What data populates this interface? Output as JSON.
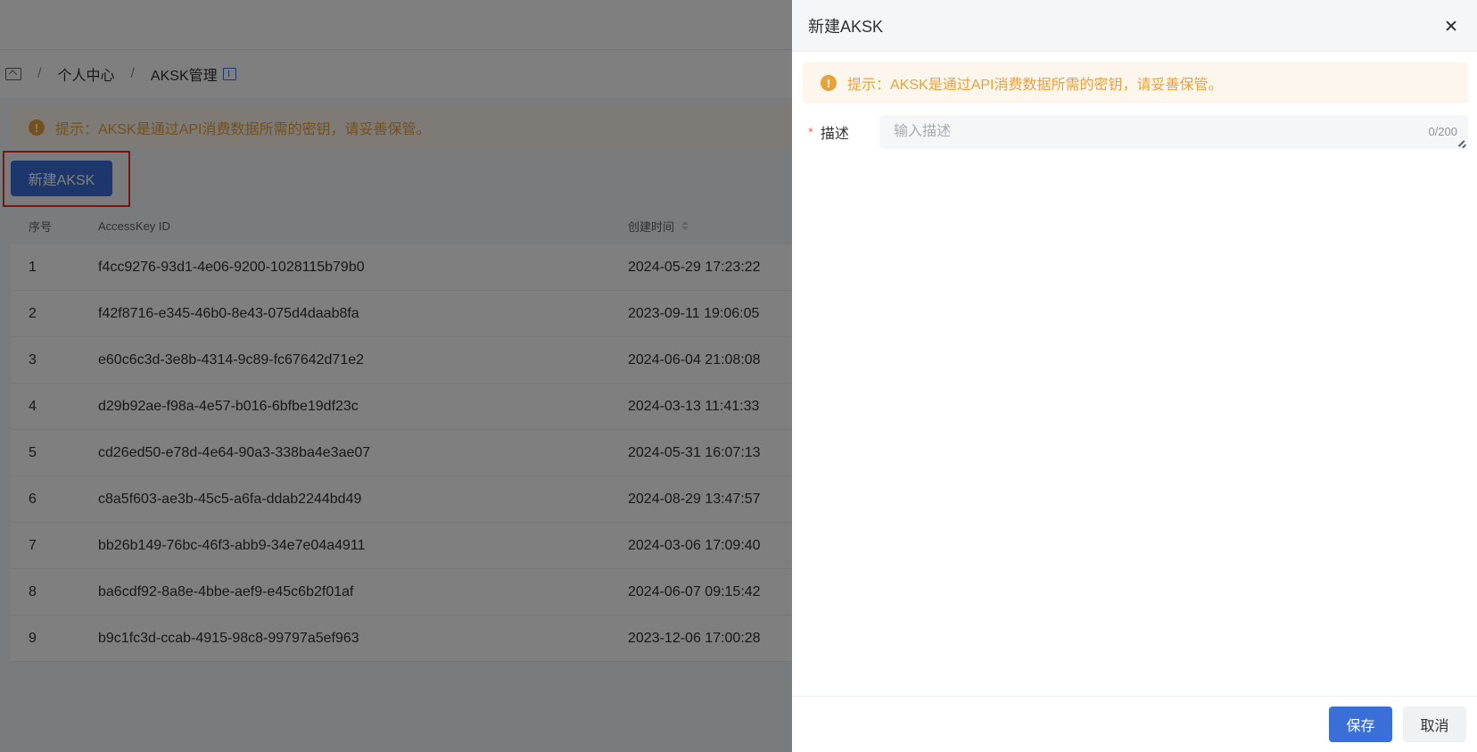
{
  "breadcrumb": {
    "items": [
      "个人中心",
      "AKSK管理"
    ],
    "separator": "/"
  },
  "page": {
    "tip": "提示：AKSK是通过API消费数据所需的密钥，请妥善保管。",
    "new_button": "新建AKSK"
  },
  "table": {
    "headers": {
      "index": "序号",
      "access_key_id": "AccessKey ID",
      "created_time": "创建时间"
    },
    "rows": [
      {
        "index": "1",
        "access_key_id": "f4cc9276-93d1-4e06-9200-1028115b79b0",
        "created_time": "2024-05-29 17:23:22"
      },
      {
        "index": "2",
        "access_key_id": "f42f8716-e345-46b0-8e43-075d4daab8fa",
        "created_time": "2023-09-11 19:06:05"
      },
      {
        "index": "3",
        "access_key_id": "e60c6c3d-3e8b-4314-9c89-fc67642d71e2",
        "created_time": "2024-06-04 21:08:08"
      },
      {
        "index": "4",
        "access_key_id": "d29b92ae-f98a-4e57-b016-6bfbe19df23c",
        "created_time": "2024-03-13 11:41:33"
      },
      {
        "index": "5",
        "access_key_id": "cd26ed50-e78d-4e64-90a3-338ba4e3ae07",
        "created_time": "2024-05-31 16:07:13"
      },
      {
        "index": "6",
        "access_key_id": "c8a5f603-ae3b-45c5-a6fa-ddab2244bd49",
        "created_time": "2024-08-29 13:47:57"
      },
      {
        "index": "7",
        "access_key_id": "bb26b149-76bc-46f3-abb9-34e7e04a4911",
        "created_time": "2024-03-06 17:09:40"
      },
      {
        "index": "8",
        "access_key_id": "ba6cdf92-8a8e-4bbe-aef9-e45c6b2f01af",
        "created_time": "2024-06-07 09:15:42"
      },
      {
        "index": "9",
        "access_key_id": "b9c1fc3d-ccab-4915-98c8-99797a5ef963",
        "created_time": "2023-12-06 17:00:28"
      }
    ]
  },
  "drawer": {
    "title": "新建AKSK",
    "tip": "提示：AKSK是通过API消费数据所需的密钥，请妥善保管。",
    "form": {
      "required_mark": "*",
      "desc_label": "描述",
      "desc_value": "",
      "desc_placeholder": "输入描述",
      "desc_counter": "0/200"
    },
    "save_label": "保存",
    "cancel_label": "取消"
  },
  "icons": {
    "warning": "!",
    "close": "close-icon",
    "home": "home-icon",
    "doc": "book-icon"
  },
  "colors": {
    "primary": "#3a6fd8",
    "warning": "#e6a23c",
    "warning_bg": "#fdf6ec",
    "highlight": "#e8302a"
  }
}
